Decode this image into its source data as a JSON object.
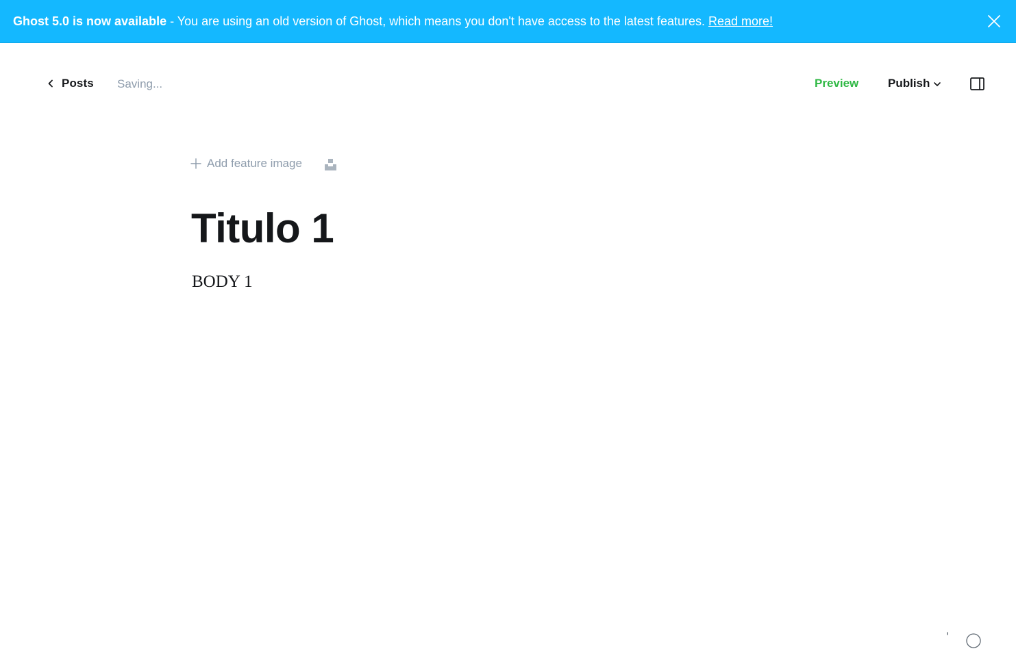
{
  "banner": {
    "headline": "Ghost 5.0 is now available",
    "message": " - You are using an old version of Ghost, which means you don't have access to the latest features. ",
    "link_label": "Read more!",
    "background_color": "#14b8ff",
    "close_icon": "close-icon"
  },
  "header": {
    "back_label": "Posts",
    "back_icon": "chevron-left-icon",
    "save_status": "Saving...",
    "preview_label": "Preview",
    "preview_color": "#2fb844",
    "publish_label": "Publish",
    "publish_icon": "chevron-down-icon",
    "settings_icon": "sidebar-toggle-icon"
  },
  "editor": {
    "feature_image_label": "Add feature image",
    "feature_image_icon": "plus-icon",
    "unsplash_icon": "unsplash-icon",
    "title": "Titulo 1",
    "body": "BODY 1"
  }
}
